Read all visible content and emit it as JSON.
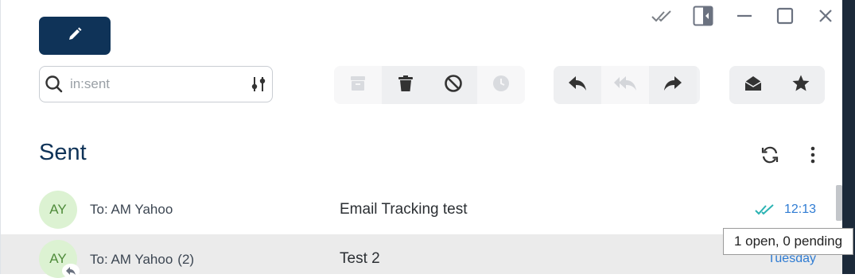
{
  "window": {
    "controls": [
      "double-check-icon",
      "sidebar-collapse-icon",
      "minimize-icon",
      "maximize-icon",
      "close-icon"
    ]
  },
  "compose": {
    "icon": "pencil-icon"
  },
  "search": {
    "value": "",
    "placeholder": "in:sent",
    "icon": "search-icon",
    "filter_icon": "sliders-icon"
  },
  "toolbar": {
    "group1": [
      {
        "icon": "archive-icon",
        "enabled": false
      },
      {
        "icon": "trash-icon",
        "enabled": true
      },
      {
        "icon": "block-icon",
        "enabled": true
      },
      {
        "icon": "snooze-clock-icon",
        "enabled": false
      }
    ],
    "group2": [
      {
        "icon": "reply-icon",
        "enabled": true
      },
      {
        "icon": "reply-all-icon",
        "enabled": false
      },
      {
        "icon": "forward-icon",
        "enabled": true
      }
    ],
    "group3": [
      {
        "icon": "mark-read-envelope-icon",
        "enabled": true
      },
      {
        "icon": "star-icon",
        "enabled": true
      }
    ]
  },
  "folder": {
    "title": "Sent",
    "refresh_icon": "refresh-icon",
    "more_icon": "more-vertical-icon"
  },
  "messages": [
    {
      "initials": "AY",
      "recipient": "To: AM Yahoo",
      "count": "",
      "subject": "Email Tracking test",
      "time": "12:13",
      "tracked": true
    },
    {
      "initials": "AY",
      "recipient": "To: AM Yahoo",
      "count": "(2)",
      "subject": "Test 2",
      "time": "Tuesday",
      "tracked": false
    }
  ],
  "tooltip": {
    "text": "1 open, 0 pending"
  },
  "colors": {
    "accent": "#0f3358",
    "link_blue": "#2f7cd3",
    "tracking_teal": "#2bb3b3",
    "avatar_bg": "#dcf2d2",
    "avatar_fg": "#4f8b3a"
  }
}
